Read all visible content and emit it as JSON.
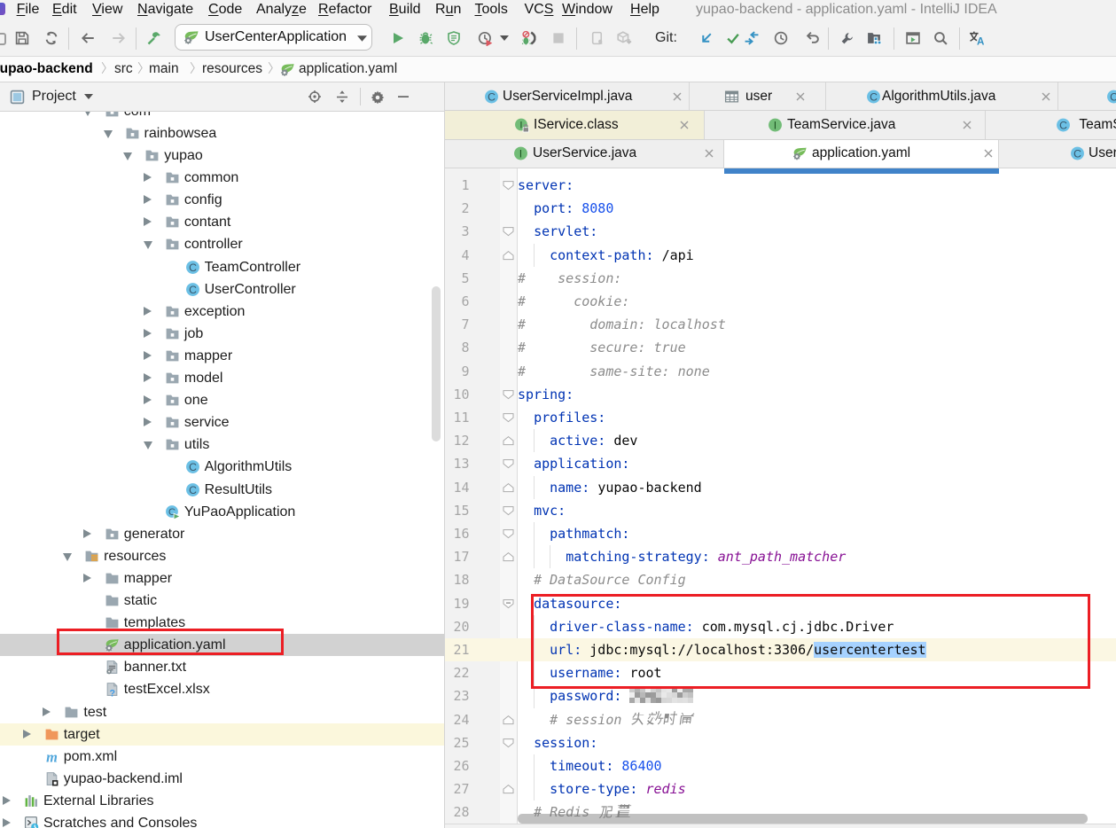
{
  "window": {
    "title": "yupao-backend - application.yaml - IntelliJ IDEA"
  },
  "menu": {
    "items": [
      {
        "label": "File",
        "mnemonic": 0
      },
      {
        "label": "Edit",
        "mnemonic": 0
      },
      {
        "label": "View",
        "mnemonic": 0
      },
      {
        "label": "Navigate",
        "mnemonic": 0
      },
      {
        "label": "Code",
        "mnemonic": 0
      },
      {
        "label": "Analyze",
        "mnemonic": 5
      },
      {
        "label": "Refactor",
        "mnemonic": 0
      },
      {
        "label": "Build",
        "mnemonic": 0
      },
      {
        "label": "Run",
        "mnemonic": 1
      },
      {
        "label": "Tools",
        "mnemonic": 0
      },
      {
        "label": "VCS",
        "mnemonic": 2
      },
      {
        "label": "Window",
        "mnemonic": 0
      },
      {
        "label": "Help",
        "mnemonic": 0
      }
    ]
  },
  "toolbar": {
    "run_configuration": "UserCenterApplication",
    "git_label": "Git:",
    "icons": [
      "save",
      "refresh",
      "back",
      "forward",
      "build-hammer",
      "run",
      "debug",
      "coverage",
      "profiler",
      "attach-debugger",
      "stop",
      "device",
      "dump",
      "vcs-update",
      "vcs-commit",
      "vcs-merge",
      "vcs-history",
      "vcs-rollback",
      "settings-wrench",
      "project-structure",
      "run-anything",
      "search-everywhere",
      "translate"
    ]
  },
  "breadcrumbs": {
    "items": [
      "yupao-backend",
      "src",
      "main",
      "resources",
      "application.yaml"
    ]
  },
  "project_panel": {
    "title": "Project",
    "header_icons": [
      "locate",
      "collapse-all",
      "settings-gear",
      "hide"
    ],
    "tree": [
      {
        "label": "com",
        "depth": 4,
        "icon": "pkg",
        "arrow": "open"
      },
      {
        "label": "rainbowsea",
        "depth": 5,
        "icon": "pkg",
        "arrow": "open"
      },
      {
        "label": "yupao",
        "depth": 6,
        "icon": "pkg",
        "arrow": "open"
      },
      {
        "label": "common",
        "depth": 7,
        "icon": "pkg",
        "arrow": "closed"
      },
      {
        "label": "config",
        "depth": 7,
        "icon": "pkg",
        "arrow": "closed"
      },
      {
        "label": "contant",
        "depth": 7,
        "icon": "pkg",
        "arrow": "closed"
      },
      {
        "label": "controller",
        "depth": 7,
        "icon": "pkg",
        "arrow": "open"
      },
      {
        "label": "TeamController",
        "depth": 8,
        "icon": "class",
        "arrow": "none"
      },
      {
        "label": "UserController",
        "depth": 8,
        "icon": "class",
        "arrow": "none"
      },
      {
        "label": "exception",
        "depth": 7,
        "icon": "pkg",
        "arrow": "closed"
      },
      {
        "label": "job",
        "depth": 7,
        "icon": "pkg",
        "arrow": "closed"
      },
      {
        "label": "mapper",
        "depth": 7,
        "icon": "pkg",
        "arrow": "closed"
      },
      {
        "label": "model",
        "depth": 7,
        "icon": "pkg",
        "arrow": "closed"
      },
      {
        "label": "one",
        "depth": 7,
        "icon": "pkg",
        "arrow": "closed"
      },
      {
        "label": "service",
        "depth": 7,
        "icon": "pkg",
        "arrow": "closed"
      },
      {
        "label": "utils",
        "depth": 7,
        "icon": "pkg",
        "arrow": "open"
      },
      {
        "label": "AlgorithmUtils",
        "depth": 8,
        "icon": "class",
        "arrow": "none"
      },
      {
        "label": "ResultUtils",
        "depth": 8,
        "icon": "class",
        "arrow": "none"
      },
      {
        "label": "YuPaoApplication",
        "depth": 7,
        "icon": "class-run",
        "arrow": "none"
      },
      {
        "label": "generator",
        "depth": 4,
        "icon": "pkg",
        "arrow": "closed"
      },
      {
        "label": "resources",
        "depth": 3,
        "icon": "res-folder",
        "arrow": "open"
      },
      {
        "label": "mapper",
        "depth": 4,
        "icon": "folder",
        "arrow": "closed"
      },
      {
        "label": "static",
        "depth": 4,
        "icon": "folder",
        "arrow": "none"
      },
      {
        "label": "templates",
        "depth": 4,
        "icon": "folder",
        "arrow": "none"
      },
      {
        "label": "application.yaml",
        "depth": 4,
        "icon": "spring",
        "arrow": "none",
        "selected": true,
        "red_box": true
      },
      {
        "label": "banner.txt",
        "depth": 4,
        "icon": "text-file",
        "arrow": "none"
      },
      {
        "label": "testExcel.xlsx",
        "depth": 4,
        "icon": "unknown-file",
        "arrow": "none"
      },
      {
        "label": "test",
        "depth": 2,
        "icon": "folder",
        "arrow": "closed"
      },
      {
        "label": "target",
        "depth": 1,
        "icon": "folder-excluded",
        "arrow": "closed",
        "excluded": true
      },
      {
        "label": "pom.xml",
        "depth": 1,
        "icon": "maven",
        "arrow": "none"
      },
      {
        "label": "yupao-backend.iml",
        "depth": 1,
        "icon": "iml-file",
        "arrow": "none"
      },
      {
        "label": "External Libraries",
        "depth": 0,
        "icon": "library",
        "arrow": "closed"
      },
      {
        "label": "Scratches and Consoles",
        "depth": 0,
        "icon": "scratches",
        "arrow": "closed"
      }
    ]
  },
  "editor_tabs": {
    "rows": [
      [
        {
          "label": "UserServiceImpl.java",
          "icon": "class",
          "closeable": true
        },
        {
          "label": "user",
          "icon": "table",
          "closeable": true
        },
        {
          "label": "AlgorithmUtils.java",
          "icon": "class",
          "closeable": true
        },
        {
          "label": "",
          "icon": "class",
          "closeable": false
        }
      ],
      [
        {
          "label": "IService.class",
          "icon": "interface-lock",
          "closeable": true,
          "yellowed": true
        },
        {
          "label": "TeamService.java",
          "icon": "interface",
          "closeable": true
        },
        {
          "label": "TeamS",
          "icon": "class",
          "closeable": false
        }
      ],
      [
        {
          "label": "UserService.java",
          "icon": "interface",
          "closeable": true
        },
        {
          "label": "application.yaml",
          "icon": "spring",
          "closeable": true,
          "active": true
        },
        {
          "label": "User",
          "icon": "class",
          "closeable": false
        }
      ]
    ]
  },
  "editor": {
    "language": "yaml",
    "caret_line": 21,
    "selection_text": "usercentertest",
    "password_redacted": true,
    "lines": [
      {
        "n": 1,
        "fold": "start",
        "segs": [
          [
            "k",
            "server:"
          ]
        ]
      },
      {
        "n": 2,
        "fold": "",
        "segs": [
          [
            "p",
            "  "
          ],
          [
            "k",
            "port:"
          ],
          [
            "p",
            " "
          ],
          [
            "n",
            "8080"
          ]
        ]
      },
      {
        "n": 3,
        "fold": "start",
        "segs": [
          [
            "p",
            "  "
          ],
          [
            "k",
            "servlet:"
          ]
        ]
      },
      {
        "n": 4,
        "fold": "end",
        "segs": [
          [
            "p",
            "    "
          ],
          [
            "k",
            "context-path:"
          ],
          [
            "p",
            " "
          ],
          [
            "v",
            "/api"
          ]
        ]
      },
      {
        "n": 5,
        "fold": "",
        "segs": [
          [
            "c",
            "#    session:"
          ]
        ]
      },
      {
        "n": 6,
        "fold": "",
        "segs": [
          [
            "c",
            "#      cookie:"
          ]
        ]
      },
      {
        "n": 7,
        "fold": "",
        "segs": [
          [
            "c",
            "#        domain: localhost"
          ]
        ]
      },
      {
        "n": 8,
        "fold": "",
        "segs": [
          [
            "c",
            "#        secure: true"
          ]
        ]
      },
      {
        "n": 9,
        "fold": "",
        "segs": [
          [
            "c",
            "#        same-site: none"
          ]
        ]
      },
      {
        "n": 10,
        "fold": "start",
        "segs": [
          [
            "k",
            "spring:"
          ]
        ]
      },
      {
        "n": 11,
        "fold": "start",
        "segs": [
          [
            "p",
            "  "
          ],
          [
            "k",
            "profiles:"
          ]
        ]
      },
      {
        "n": 12,
        "fold": "end",
        "segs": [
          [
            "p",
            "    "
          ],
          [
            "k",
            "active:"
          ],
          [
            "p",
            " "
          ],
          [
            "v",
            "dev"
          ]
        ]
      },
      {
        "n": 13,
        "fold": "start",
        "segs": [
          [
            "p",
            "  "
          ],
          [
            "k",
            "application:"
          ]
        ]
      },
      {
        "n": 14,
        "fold": "end",
        "segs": [
          [
            "p",
            "    "
          ],
          [
            "k",
            "name:"
          ],
          [
            "p",
            " "
          ],
          [
            "v",
            "yupao-backend"
          ]
        ]
      },
      {
        "n": 15,
        "fold": "start",
        "segs": [
          [
            "p",
            "  "
          ],
          [
            "k",
            "mvc:"
          ]
        ]
      },
      {
        "n": 16,
        "fold": "start",
        "segs": [
          [
            "p",
            "    "
          ],
          [
            "k",
            "pathmatch:"
          ]
        ]
      },
      {
        "n": 17,
        "fold": "end",
        "segs": [
          [
            "p",
            "      "
          ],
          [
            "k",
            "matching-strategy:"
          ],
          [
            "p",
            " "
          ],
          [
            "m",
            "ant_path_matcher"
          ]
        ]
      },
      {
        "n": 18,
        "fold": "",
        "segs": [
          [
            "p",
            "  "
          ],
          [
            "c",
            "# DataSource Config"
          ]
        ]
      },
      {
        "n": 19,
        "fold": "start-minus",
        "segs": [
          [
            "p",
            "  "
          ],
          [
            "k",
            "datasource:"
          ]
        ]
      },
      {
        "n": 20,
        "fold": "",
        "segs": [
          [
            "p",
            "    "
          ],
          [
            "k",
            "driver-class-name:"
          ],
          [
            "p",
            " "
          ],
          [
            "v",
            "com.mysql.cj.jdbc.Driver"
          ]
        ]
      },
      {
        "n": 21,
        "fold": "",
        "segs": [
          [
            "p",
            "    "
          ],
          [
            "k",
            "url:"
          ],
          [
            "p",
            " "
          ],
          [
            "v",
            "jdbc:mysql://localhost:3306/"
          ],
          [
            "sel",
            "usercentertest"
          ]
        ],
        "caret": true
      },
      {
        "n": 22,
        "fold": "",
        "segs": [
          [
            "p",
            "    "
          ],
          [
            "k",
            "username:"
          ],
          [
            "p",
            " "
          ],
          [
            "v",
            "root"
          ]
        ]
      },
      {
        "n": 23,
        "fold": "",
        "segs": [
          [
            "p",
            "    "
          ],
          [
            "k",
            "password:"
          ],
          [
            "p",
            " "
          ],
          [
            "px",
            ""
          ]
        ]
      },
      {
        "n": 24,
        "fold": "end",
        "segs": [
          [
            "p",
            "    "
          ],
          [
            "c",
            "# session "
          ],
          [
            "cjk",
            "失效时间"
          ]
        ]
      },
      {
        "n": 25,
        "fold": "start",
        "segs": [
          [
            "p",
            "  "
          ],
          [
            "k",
            "session:"
          ]
        ]
      },
      {
        "n": 26,
        "fold": "",
        "segs": [
          [
            "p",
            "    "
          ],
          [
            "k",
            "timeout:"
          ],
          [
            "p",
            " "
          ],
          [
            "n",
            "86400"
          ]
        ]
      },
      {
        "n": 27,
        "fold": "end",
        "segs": [
          [
            "p",
            "    "
          ],
          [
            "k",
            "store-type:"
          ],
          [
            "p",
            " "
          ],
          [
            "m",
            "redis"
          ]
        ]
      },
      {
        "n": 28,
        "fold": "",
        "segs": [
          [
            "p",
            "  "
          ],
          [
            "c",
            "# Redis "
          ],
          [
            "cjk",
            "配置"
          ]
        ]
      }
    ],
    "indent_guides": [
      {
        "col": 2,
        "from": 4,
        "to": 4
      },
      {
        "col": 2,
        "from": 12,
        "to": 12
      },
      {
        "col": 2,
        "from": 14,
        "to": 14
      },
      {
        "col": 2,
        "from": 16,
        "to": 17
      },
      {
        "col": 4,
        "from": 17,
        "to": 17
      },
      {
        "col": 2,
        "from": 20,
        "to": 23
      },
      {
        "col": 2,
        "from": 26,
        "to": 27
      }
    ]
  },
  "colors": {
    "accent_blue": "#4083C9",
    "yaml_key": "#0033B3",
    "yaml_number": "#1750EB",
    "comment": "#8C8C8C",
    "meta_value": "#871094",
    "selection_bg": "#A6D2FF",
    "caret_row_bg": "#FBF7E3",
    "annotation_red": "#EC1E24",
    "tree_selection": "#D2D2D2",
    "excluded_row": "#FBF7DC",
    "run_green": "#59A869",
    "vcs_blue": "#3592C4"
  }
}
